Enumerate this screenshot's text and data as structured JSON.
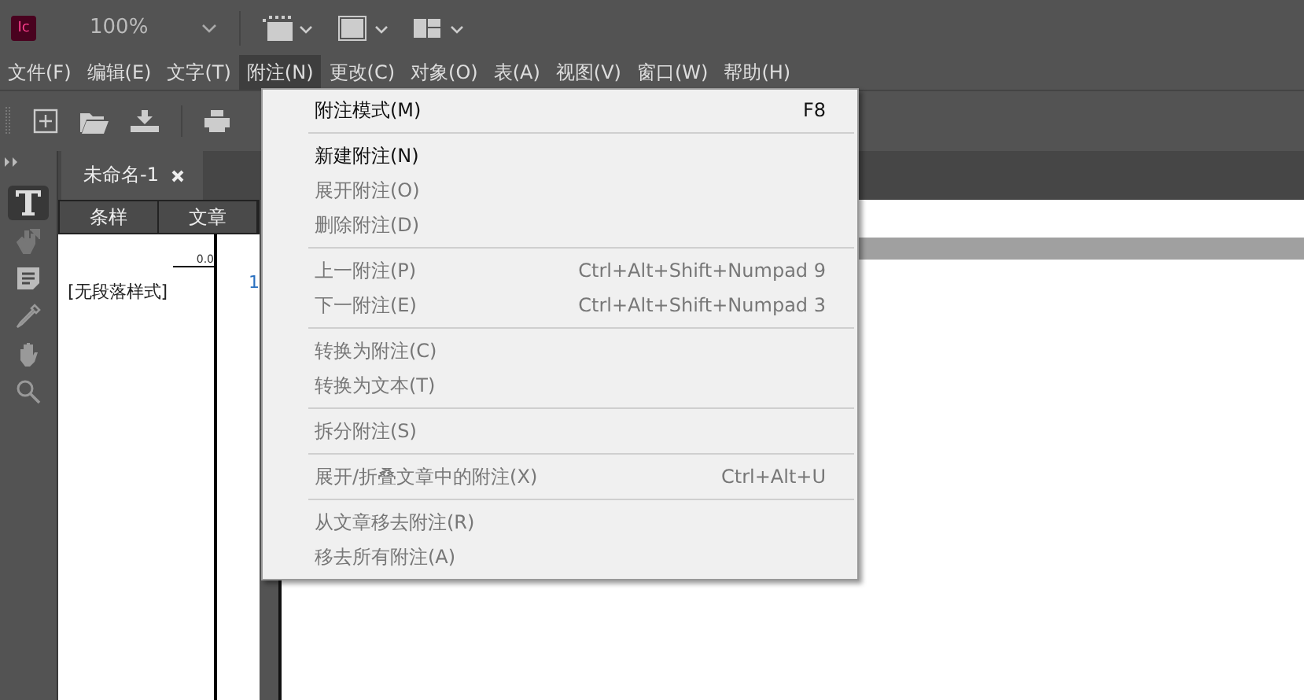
{
  "app_bar": {
    "logo": "Ic",
    "zoom": "100%"
  },
  "menubar": [
    {
      "label": "文件(F)",
      "selected": false
    },
    {
      "label": "编辑(E)",
      "selected": false
    },
    {
      "label": "文字(T)",
      "selected": false
    },
    {
      "label": "附注(N)",
      "selected": true
    },
    {
      "label": "更改(C)",
      "selected": false
    },
    {
      "label": "对象(O)",
      "selected": false
    },
    {
      "label": "表(A)",
      "selected": false
    },
    {
      "label": "视图(V)",
      "selected": false
    },
    {
      "label": "窗口(W)",
      "selected": false
    },
    {
      "label": "帮助(H)",
      "selected": false
    }
  ],
  "tools": [
    {
      "kind": "type",
      "selected": true
    },
    {
      "kind": "position",
      "selected": false
    },
    {
      "kind": "note",
      "selected": false
    },
    {
      "kind": "eyedropper",
      "selected": false
    },
    {
      "kind": "hand",
      "selected": false
    },
    {
      "kind": "zoom",
      "selected": false
    }
  ],
  "document_tab": {
    "title": "未命名-1"
  },
  "story_editor": {
    "columns": [
      "条样",
      "文章"
    ],
    "ruler": "0.0",
    "style_label": "[无段落样式]",
    "line_number": "1"
  },
  "menu": [
    [
      {
        "label": "附注模式(M)",
        "shortcut": "F8",
        "disabled": false
      }
    ],
    [
      {
        "label": "新建附注(N)",
        "disabled": false
      },
      {
        "label": "展开附注(O)",
        "disabled": true
      },
      {
        "label": "删除附注(D)",
        "disabled": true
      }
    ],
    [
      {
        "label": "上一附注(P)",
        "shortcut": "Ctrl+Alt+Shift+Numpad 9",
        "disabled": true
      },
      {
        "label": "下一附注(E)",
        "shortcut": "Ctrl+Alt+Shift+Numpad 3",
        "disabled": true
      }
    ],
    [
      {
        "label": "转换为附注(C)",
        "disabled": true
      },
      {
        "label": "转换为文本(T)",
        "disabled": true
      }
    ],
    [
      {
        "label": "拆分附注(S)",
        "disabled": true
      }
    ],
    [
      {
        "label": "展开/折叠文章中的附注(X)",
        "shortcut": "Ctrl+Alt+U",
        "disabled": true
      }
    ],
    [
      {
        "label": "从文章移去附注(R)",
        "disabled": true
      },
      {
        "label": "移去所有附注(A)",
        "disabled": true
      }
    ]
  ]
}
